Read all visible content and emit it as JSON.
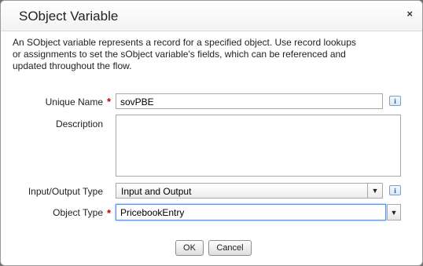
{
  "dialog": {
    "title": "SObject Variable",
    "close_glyph": "×",
    "intro": "An SObject variable represents a record for a specified object. Use record lookups or assignments to set the sObject variable's fields, which can be referenced and updated throughout the flow."
  },
  "form": {
    "unique_name": {
      "label": "Unique Name",
      "value": "sovPBE",
      "required": true
    },
    "description": {
      "label": "Description",
      "value": ""
    },
    "io_type": {
      "label": "Input/Output Type",
      "value": "Input and Output"
    },
    "object_type": {
      "label": "Object Type",
      "value": "PricebookEntry",
      "required": true
    },
    "required_glyph": "*",
    "info_glyph": "i",
    "dropdown_glyph": "▼"
  },
  "buttons": {
    "ok": "OK",
    "cancel": "Cancel"
  },
  "icons": [
    "close-icon",
    "info-icon",
    "chevron-down-icon"
  ],
  "colors": {
    "required": "#cc0000",
    "focus": "#4d90fe",
    "info": "#1d5a9a"
  }
}
